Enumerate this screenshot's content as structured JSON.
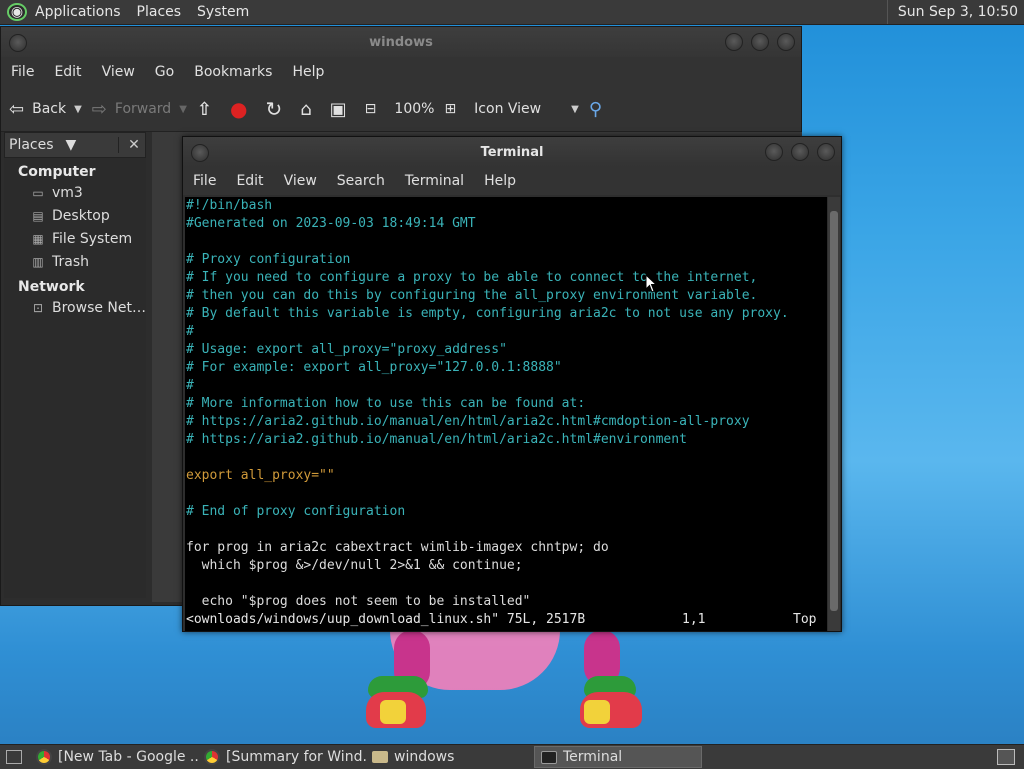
{
  "top_panel": {
    "menus": [
      "Applications",
      "Places",
      "System"
    ],
    "clock": "Sun Sep  3, 10:50"
  },
  "file_manager": {
    "title": "windows",
    "menus": [
      "File",
      "Edit",
      "View",
      "Go",
      "Bookmarks",
      "Help"
    ],
    "toolbar": {
      "back": "Back",
      "forward": "Forward",
      "zoom": "100%",
      "view_mode": "Icon View"
    },
    "sidebar": {
      "header": "Places",
      "groups": [
        {
          "label": "Computer",
          "items": [
            {
              "label": "vm3",
              "icon": "drive-icon"
            },
            {
              "label": "Desktop",
              "icon": "desktop-icon"
            },
            {
              "label": "File System",
              "icon": "filesystem-icon"
            },
            {
              "label": "Trash",
              "icon": "trash-icon"
            }
          ]
        },
        {
          "label": "Network",
          "items": [
            {
              "label": "Browse Net…",
              "icon": "network-icon"
            }
          ]
        }
      ]
    }
  },
  "terminal": {
    "title": "Terminal",
    "menus": [
      "File",
      "Edit",
      "View",
      "Search",
      "Terminal",
      "Help"
    ],
    "lines": [
      "#!/bin/bash",
      "#Generated on 2023-09-03 18:49:14 GMT",
      "",
      "# Proxy configuration",
      "# If you need to configure a proxy to be able to connect to the internet,",
      "# then you can do this by configuring the all_proxy environment variable.",
      "# By default this variable is empty, configuring aria2c to not use any proxy.",
      "#",
      "# Usage: export all_proxy=\"proxy_address\"",
      "# For example: export all_proxy=\"127.0.0.1:8888\"",
      "#",
      "# More information how to use this can be found at:",
      "# https://aria2.github.io/manual/en/html/aria2c.html#cmdoption-all-proxy",
      "# https://aria2.github.io/manual/en/html/aria2c.html#environment",
      "",
      "export all_proxy=\"\"",
      "",
      "# End of proxy configuration",
      "",
      "for prog in aria2c cabextract wimlib-imagex chntpw; do",
      "  which $prog &>/dev/null 2>&1 && continue;",
      "",
      "  echo \"$prog does not seem to be installed\""
    ],
    "status": {
      "file": "<ownloads/windows/uup_download_linux.sh\" 75L, 2517B",
      "position": "1,1",
      "scroll": "Top"
    }
  },
  "taskbar": {
    "tasks": [
      {
        "label": "[New Tab - Google ...",
        "icon": "chrome-icon"
      },
      {
        "label": "[Summary for Wind...",
        "icon": "chrome-icon"
      },
      {
        "label": "windows",
        "icon": "folder-icon"
      },
      {
        "label": "Terminal",
        "icon": "terminal-icon",
        "active": true
      }
    ]
  }
}
